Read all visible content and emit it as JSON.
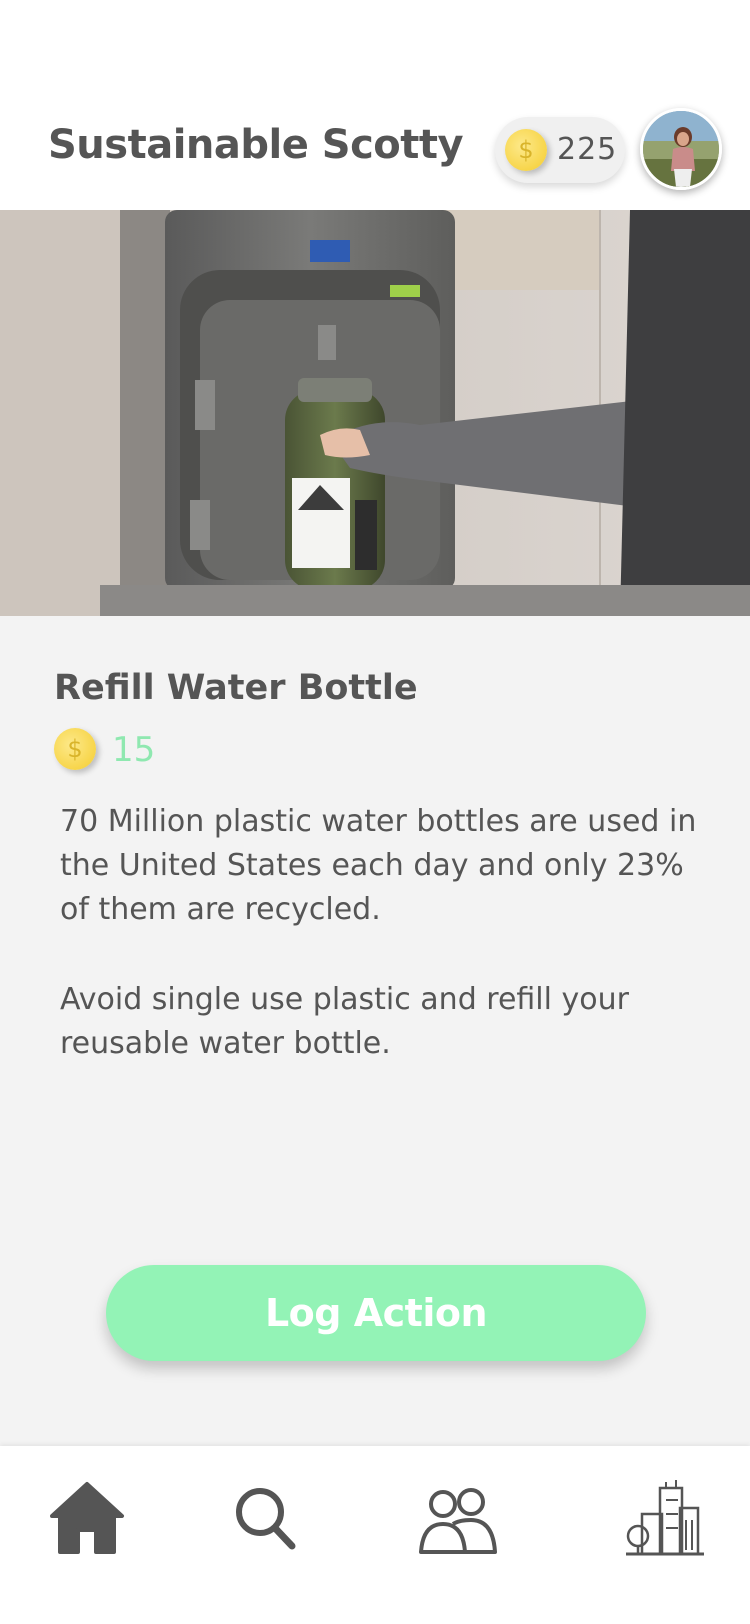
{
  "header": {
    "title": "Sustainable Scotty",
    "coins": "225",
    "coin_symbol": "$",
    "avatar_icon": "profile-avatar"
  },
  "action": {
    "title": "Refill Water Bottle",
    "reward": "15",
    "reward_symbol": "$",
    "description_1": "70 Million plastic water bottles are used in the United States each day and only 23% of them are recycled.",
    "description_2": "Avoid single use plastic and refill your reusable water bottle.",
    "button_label": "Log Action"
  },
  "tabs": [
    {
      "icon": "home-icon",
      "active": true
    },
    {
      "icon": "search-icon",
      "active": false
    },
    {
      "icon": "people-icon",
      "active": false
    },
    {
      "icon": "city-icon",
      "active": false
    }
  ],
  "colors": {
    "accent_green": "#93f3b6",
    "reward_green": "#8fe8b0",
    "coin_gold": "#f7d54a",
    "text_gray": "#555555",
    "background": "#f3f3f3"
  }
}
